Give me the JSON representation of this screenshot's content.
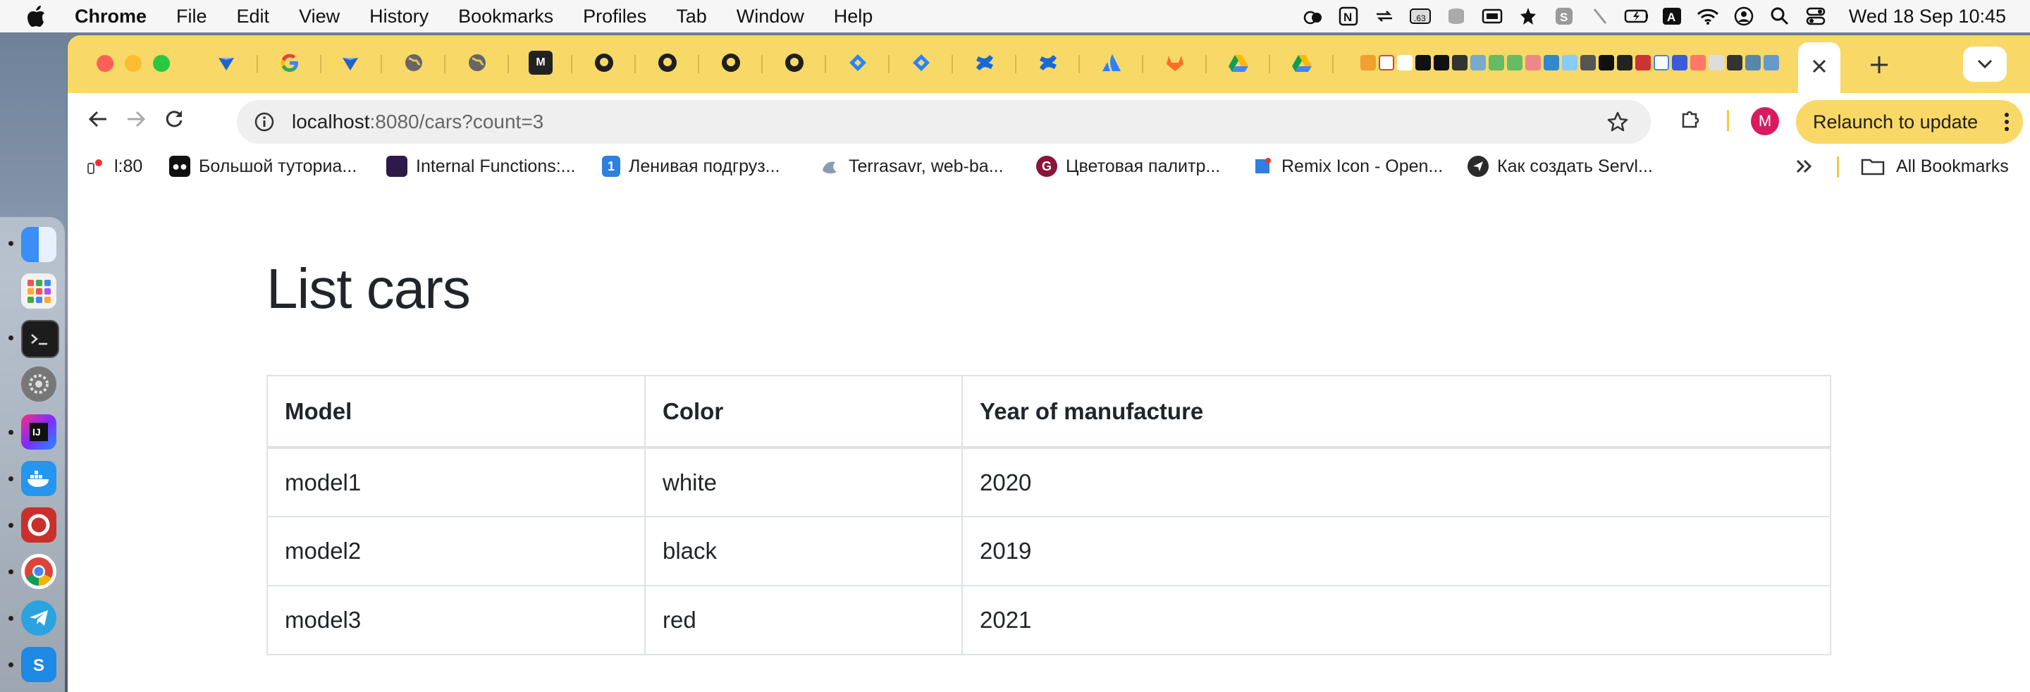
{
  "menubar": {
    "app": "Chrome",
    "items": [
      "File",
      "Edit",
      "View",
      "History",
      "Bookmarks",
      "Profiles",
      "Tab",
      "Window",
      "Help"
    ],
    "badge": ".63",
    "clock": "Wed 18 Sep  10:45"
  },
  "browser": {
    "url_host": "localhost",
    "url_rest": ":8080/cars?count=3",
    "profile_initial": "M",
    "relaunch_label": "Relaunch to update",
    "bookmarks": [
      "l:80",
      "Большой туториа...",
      "Internal Functions:...",
      "Ленивая подгруз...",
      "Terrasavr, web-ba...",
      "Цветовая палитр...",
      "Remix Icon - Open...",
      "Как создать Servl..."
    ],
    "all_bookmarks": "All Bookmarks"
  },
  "page": {
    "title": "List cars",
    "columns": [
      "Model",
      "Color",
      "Year of manufacture"
    ],
    "rows": [
      [
        "model1",
        "white",
        "2020"
      ],
      [
        "model2",
        "black",
        "2019"
      ],
      [
        "model3",
        "red",
        "2021"
      ]
    ]
  },
  "colors": {
    "tabstrip": "#f8d867",
    "profile": "#d81b60",
    "table_border": "#dee2e6"
  }
}
